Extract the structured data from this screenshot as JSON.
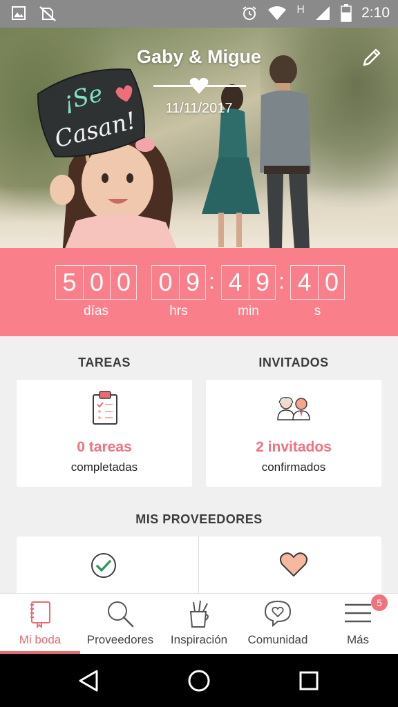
{
  "status_bar": {
    "time": "2:10",
    "network_letter": "H",
    "icons": [
      "gallery-icon",
      "no-sim-icon",
      "alarm-icon",
      "wifi-icon",
      "signal-icon",
      "battery-icon"
    ]
  },
  "hero": {
    "sign_text_line1": "¡Se",
    "sign_text_line2": "Casan!",
    "title": "Gaby & Migue",
    "date": "11/11/2017"
  },
  "countdown": {
    "days": [
      "5",
      "0",
      "0"
    ],
    "hours": [
      "0",
      "9"
    ],
    "minutes": [
      "4",
      "9"
    ],
    "seconds": [
      "4",
      "0"
    ],
    "labels": {
      "days": "días",
      "hours": "hrs",
      "minutes": "min",
      "seconds": "s"
    }
  },
  "sections": {
    "tareas": {
      "title": "TAREAS",
      "count": "0 tareas",
      "subtitle": "completadas"
    },
    "invitados": {
      "title": "INVITADOS",
      "count": "2 invitados",
      "subtitle": "confirmados"
    },
    "proveedores": {
      "title": "MIS PROVEEDORES"
    }
  },
  "bottom_nav": {
    "items": [
      {
        "label": "Mi boda",
        "icon": "notebook-icon",
        "active": true
      },
      {
        "label": "Proveedores",
        "icon": "search-icon",
        "active": false
      },
      {
        "label": "Inspiración",
        "icon": "pencil-cup-icon",
        "active": false
      },
      {
        "label": "Comunidad",
        "icon": "chat-heart-icon",
        "active": false
      },
      {
        "label": "Más",
        "icon": "menu-icon",
        "active": false
      }
    ],
    "badge_count": "5"
  },
  "colors": {
    "accent": "#f9808a",
    "accent_text": "#e86a74",
    "success": "#2e9b58",
    "heart": "#f6b9a0"
  }
}
